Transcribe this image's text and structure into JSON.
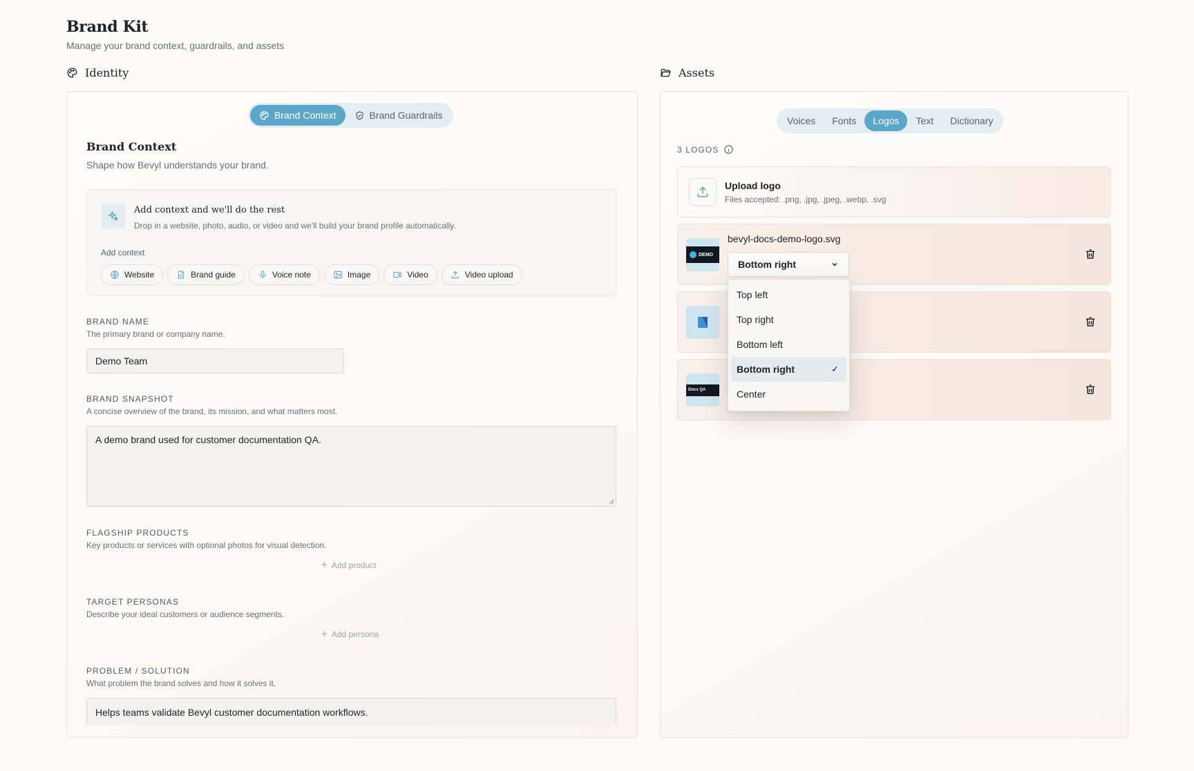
{
  "page": {
    "title": "Brand Kit",
    "subtitle": "Manage your brand context, guardrails, and assets"
  },
  "identity": {
    "heading": "Identity",
    "tabs": [
      {
        "label": "Brand Context",
        "active": true
      },
      {
        "label": "Brand Guardrails",
        "active": false
      }
    ],
    "title": "Brand Context",
    "subtitle": "Shape how Bevyl understands your brand.",
    "context_card": {
      "title": "Add context and we'll do the rest",
      "description": "Drop in a website, photo, audio, or video and we'll build your brand profile automatically.",
      "add_label": "Add context",
      "chips": [
        {
          "label": "Website",
          "icon": "globe-icon"
        },
        {
          "label": "Brand guide",
          "icon": "document-icon"
        },
        {
          "label": "Voice note",
          "icon": "microphone-icon"
        },
        {
          "label": "Image",
          "icon": "image-icon"
        },
        {
          "label": "Video",
          "icon": "video-icon"
        },
        {
          "label": "Video upload",
          "icon": "upload-icon"
        }
      ]
    },
    "brand_name": {
      "label": "BRAND NAME",
      "help": "The primary brand or company name.",
      "value": "Demo Team"
    },
    "brand_snapshot": {
      "label": "BRAND SNAPSHOT",
      "help": "A concise overview of the brand, its mission, and what matters most.",
      "value": "A demo brand used for customer documentation QA."
    },
    "flagship_products": {
      "label": "FLAGSHIP PRODUCTS",
      "help": "Key products or services with optional photos for visual detection.",
      "add_label": "Add product"
    },
    "target_personas": {
      "label": "TARGET PERSONAS",
      "help": "Describe your ideal customers or audience segments.",
      "add_label": "Add persona"
    },
    "problem_solution": {
      "label": "PROBLEM / SOLUTION",
      "help": "What problem the brand solves and how it solves it.",
      "value": "Helps teams validate Bevyl customer documentation workflows."
    }
  },
  "assets": {
    "heading": "Assets",
    "tabs": [
      {
        "label": "Voices",
        "active": false
      },
      {
        "label": "Fonts",
        "active": false
      },
      {
        "label": "Logos",
        "active": true
      },
      {
        "label": "Text",
        "active": false
      },
      {
        "label": "Dictionary",
        "active": false
      }
    ],
    "logos_count": "3 LOGOS",
    "upload": {
      "title": "Upload logo",
      "subtitle": "Files accepted: .png, .jpg, .jpeg, .webp, .svg"
    },
    "logos": [
      {
        "name": "bevyl-docs-demo-logo.svg",
        "position": "Bottom right",
        "thumb_text": "DEMO"
      },
      {
        "name": "",
        "position": "",
        "thumb_text": ""
      },
      {
        "name": "",
        "position": "",
        "thumb_text": "Docs QA"
      }
    ],
    "position_dropdown": {
      "options": [
        "Top left",
        "Top right",
        "Bottom left",
        "Bottom right",
        "Center"
      ],
      "selected": "Bottom right",
      "check": "✓"
    }
  },
  "colors": {
    "accent": "#5ba6c9",
    "accent_soft": "#e4edf2",
    "background": "#fcfbf8"
  }
}
